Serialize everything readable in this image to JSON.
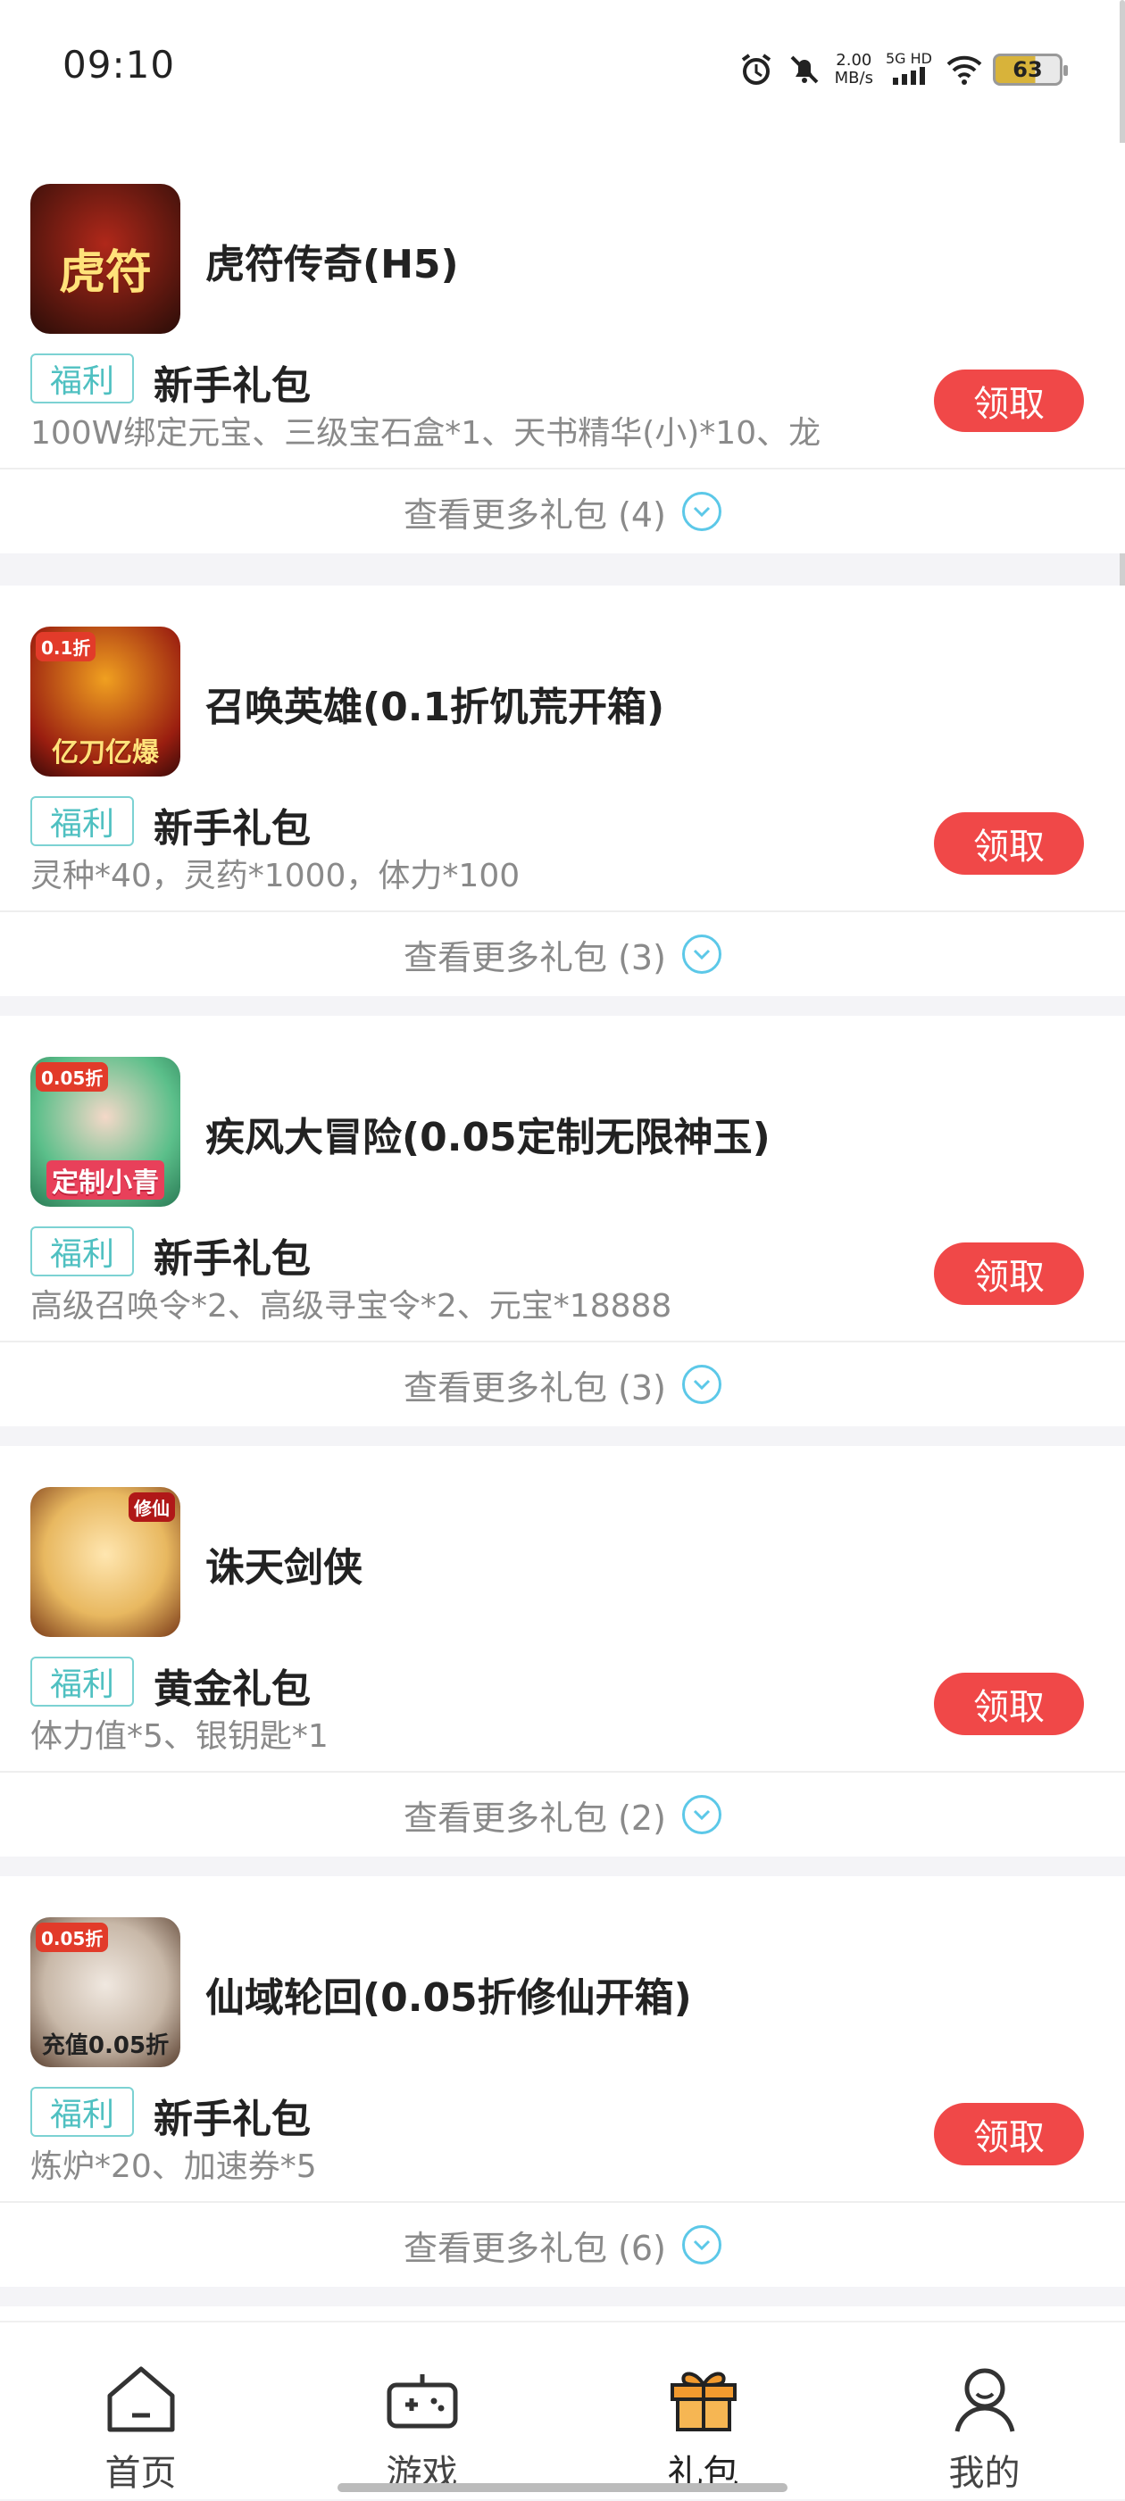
{
  "status_bar": {
    "time": "09:10",
    "net_speed_value": "2.00",
    "net_speed_unit": "MB/s",
    "signal_label": "5G HD",
    "battery": "63"
  },
  "colors": {
    "accent_red": "#f04848",
    "tag_teal": "#4fc0c1",
    "chevron_blue": "#5cc8e8",
    "tab_active_orange": "#f29a2e"
  },
  "gifts": [
    {
      "game": "虎符传奇(H5)",
      "icon_caption": "虎符",
      "icon_badge": "",
      "tag": "福利",
      "package": "新手礼包",
      "desc": "100W绑定元宝、三级宝石盒*1、天书精华(小)*10、龙",
      "button": "领取",
      "more": "查看更多礼包 (4)"
    },
    {
      "game": "召唤英雄(0.1折饥荒开箱)",
      "icon_caption": "亿刀亿爆",
      "icon_badge": "0.1折",
      "tag": "福利",
      "package": "新手礼包",
      "desc": "灵种*40，灵药*1000，体力*100",
      "button": "领取",
      "more": "查看更多礼包 (3)"
    },
    {
      "game": "疾风大冒险(0.05定制无限神玉)",
      "icon_caption": "定制小青",
      "icon_badge": "0.05折",
      "tag": "福利",
      "package": "新手礼包",
      "desc": "高级召唤令*2、高级寻宝令*2、元宝*18888",
      "button": "领取",
      "more": "查看更多礼包 (3)"
    },
    {
      "game": "诛天剑侠",
      "icon_caption": "",
      "icon_badge": "修仙",
      "tag": "福利",
      "package": "黄金礼包",
      "desc": "体力值*5、银钥匙*1",
      "button": "领取",
      "more": "查看更多礼包 (2)"
    },
    {
      "game": "仙域轮回(0.05折修仙开箱)",
      "icon_caption": "充值0.05折",
      "icon_badge": "0.05折",
      "tag": "福利",
      "package": "新手礼包",
      "desc": "炼炉*20、加速券*5",
      "button": "领取",
      "more": "查看更多礼包 (6)"
    }
  ],
  "tabs": [
    {
      "label": "首页",
      "icon": "home-icon"
    },
    {
      "label": "游戏",
      "icon": "gamepad-icon"
    },
    {
      "label": "礼包",
      "icon": "gift-icon",
      "active": true
    },
    {
      "label": "我的",
      "icon": "profile-icon"
    }
  ]
}
